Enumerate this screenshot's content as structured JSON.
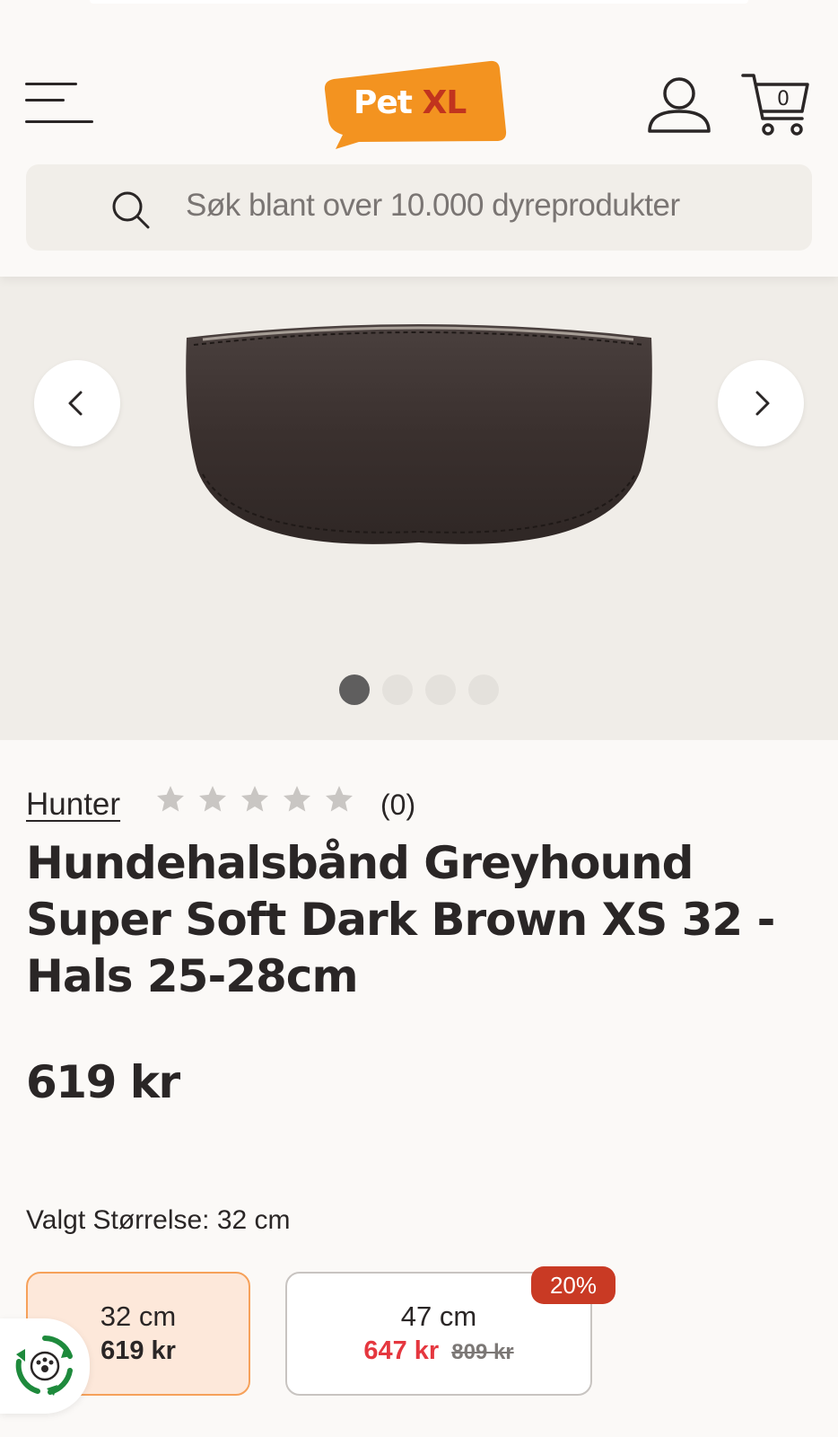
{
  "header": {
    "logo": {
      "word1": "Pet",
      "word2": "XL",
      "color_bubble": "#f39320",
      "color_word2": "#c1341e"
    },
    "cart_count": "0",
    "icons": [
      "menu-icon",
      "account-icon",
      "cart-icon"
    ]
  },
  "search": {
    "placeholder": "Søk blant over 10.000 dyreprodukter",
    "icon": "search-icon"
  },
  "gallery": {
    "slide_count": 4,
    "active_index": 0,
    "prev_icon": "chevron-left-icon",
    "next_icon": "chevron-right-icon"
  },
  "product": {
    "brand": "Hunter",
    "rating": 0,
    "rating_max": 5,
    "review_count": "(0)",
    "title": "Hundehalsbånd Greyhound Super Soft Dark Brown XS 32 - Hals 25-28cm",
    "price": "619 kr"
  },
  "size": {
    "label": "Valgt Størrelse: 32 cm",
    "variants": [
      {
        "size": "32 cm",
        "price": "619 kr",
        "selected": true
      },
      {
        "size": "47 cm",
        "sale_price": "647 kr",
        "old_price": "809 kr",
        "badge": "20%",
        "selected": false
      }
    ]
  },
  "colors": {
    "accent": "#f39320",
    "sale": "#e5373f",
    "badge": "#c93a24",
    "selected_bg": "#fde8da",
    "selected_border": "#f6a15a"
  }
}
